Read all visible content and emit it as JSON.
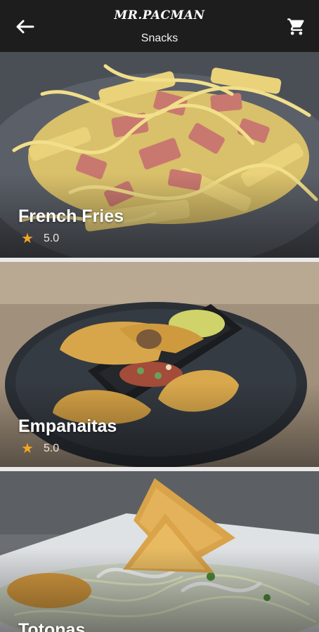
{
  "appbar": {
    "logo": "MR.PACMAN",
    "title": "Snacks",
    "back_icon": "arrow-left-icon",
    "cart_icon": "shopping-cart-icon"
  },
  "items": [
    {
      "name": "French Fries",
      "rating": "5.0"
    },
    {
      "name": "Empanaitas",
      "rating": "5.0"
    },
    {
      "name": "Totonas",
      "rating": ""
    }
  ],
  "colors": {
    "appbar": "#1d1d1d",
    "star": "#f4a620",
    "separator": "#e9e9e9"
  }
}
